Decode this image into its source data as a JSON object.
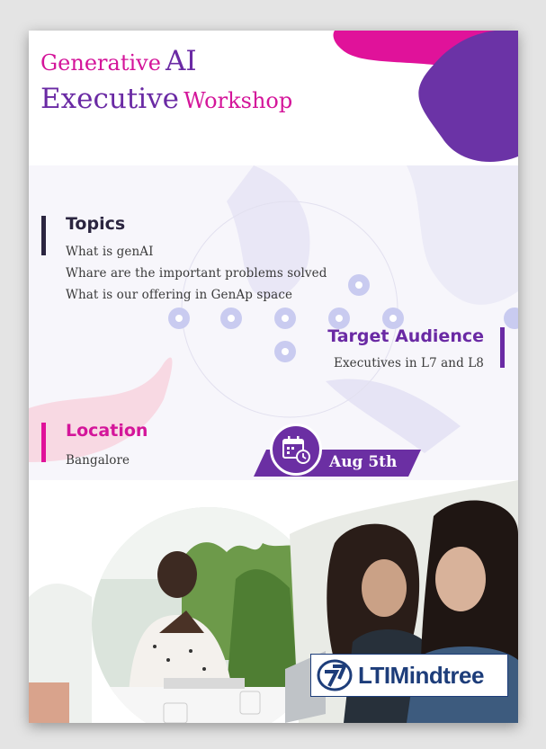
{
  "title": {
    "line1_small": "Generative",
    "line1_big": "AI",
    "line2_big": "Executive",
    "line2_small": "Workshop"
  },
  "topics": {
    "heading": "Topics",
    "items": [
      "What is genAI",
      "Whare are the important problems solved",
      "What is our offering in GenAp space"
    ]
  },
  "audience": {
    "heading": "Target Audience",
    "text": "Executives in L7 and L8"
  },
  "location": {
    "heading": "Location",
    "text": "Bangalore"
  },
  "event_date": {
    "text": "Aug 5th",
    "icon": "calendar-clock-icon"
  },
  "logo": {
    "text": "LTIMindtree",
    "icon": "lt-logo-icon"
  },
  "colors": {
    "magenta": "#d4159a",
    "purple": "#6a2aa4",
    "dark": "#2b2540",
    "logo_blue": "#1d3d7a"
  }
}
